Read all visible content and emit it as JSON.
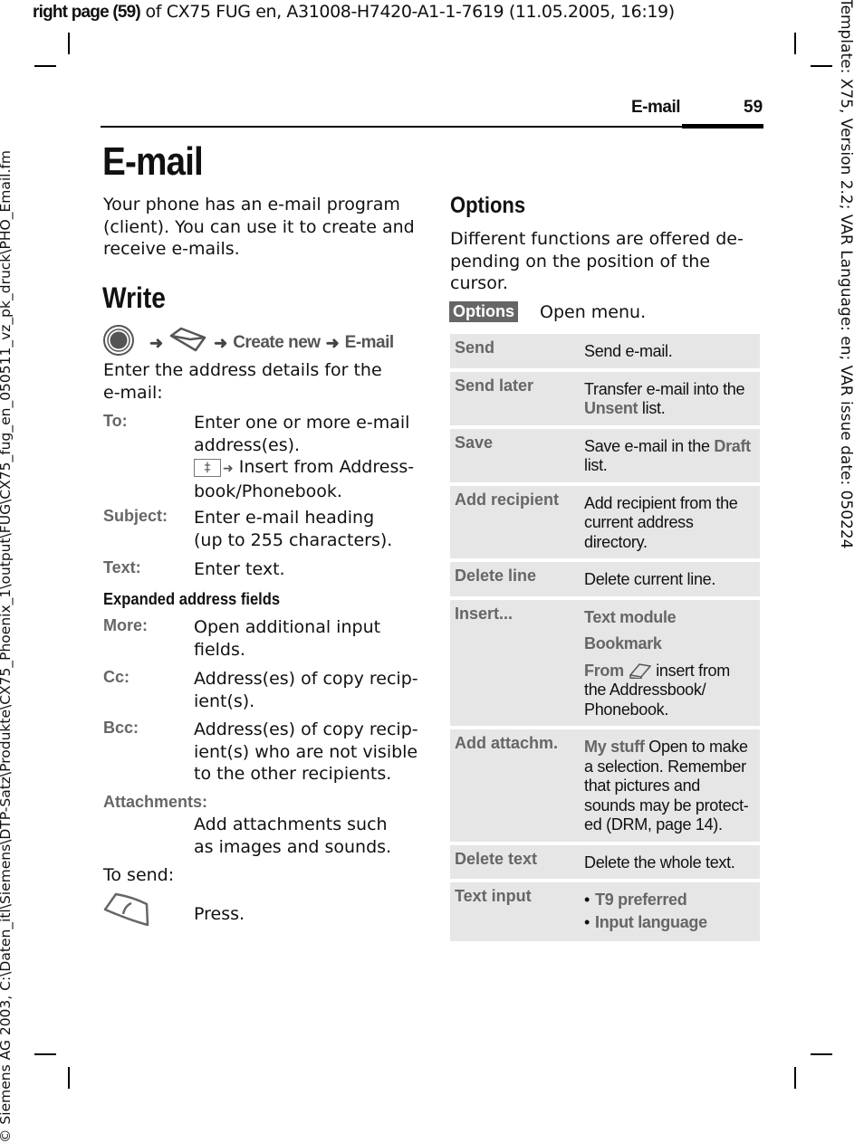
{
  "print_header": {
    "bold_part": "right page (59)",
    "rest": " of CX75 FUG en, A31008-H7420-A1-1-7619 (11.05.2005, 16:19)"
  },
  "side_left": "© Siemens AG 2003, C:\\Daten_itl\\Siemens\\DTP-Satz\\Produkte\\CX75_Phoenix_1\\output\\FUG\\CX75_fug_en_050511_vz_pk_druck\\PHO_Email.fm",
  "side_right": "Template: X75, Version 2.2; VAR Language: en; VAR issue date: 050224",
  "running_head": {
    "title": "E-mail",
    "page": "59"
  },
  "title": "E-mail",
  "intro": "Your phone has an e-mail program (client). You can use it to create and receive e-mails.",
  "write": {
    "heading": "Write",
    "nav": {
      "step1_icon": "joystick-icon",
      "step2_icon": "envelope-icon",
      "step3": "Create new",
      "step4": "E-mail",
      "arrow": "➜"
    },
    "instruction": "Enter the address details for the e-mail:",
    "fields": [
      {
        "term": "To:",
        "desc": "Enter one or more e-mail address(es).",
        "extra_key": "‡",
        "extra_arrow": "➜",
        "extra_text": "Insert from Address-book/Phonebook."
      },
      {
        "term": "Subject:",
        "desc": "Enter e-mail heading (up to 255 characters)."
      },
      {
        "term": "Text:",
        "desc": "Enter text."
      }
    ],
    "expanded_heading": "Expanded address fields",
    "expanded_fields": [
      {
        "term": "More:",
        "desc": "Open additional input fields."
      },
      {
        "term": "Cc:",
        "desc": "Address(es) of copy recip-ient(s)."
      },
      {
        "term": "Bcc:",
        "desc": "Address(es) of copy recip-ient(s) who are not visible to the other recipients."
      },
      {
        "term": "Attachments:",
        "desc": "Add attachments such as images and sounds."
      }
    ],
    "to_send": "To send:",
    "send_key_icon": "call-key-icon",
    "press": "Press."
  },
  "options": {
    "heading": "Options",
    "intro": "Different functions are offered de-pending on the position of the cursor.",
    "softkey": "Options",
    "softkey_desc": "Open menu.",
    "rows": [
      {
        "name": "Send",
        "desc": "Send e-mail."
      },
      {
        "name": "Send later",
        "desc_pre": "Transfer e-mail into the ",
        "desc_hl": "Unsent",
        "desc_post": " list."
      },
      {
        "name": "Save",
        "desc_pre": "Save e-mail in the ",
        "desc_hl": "Draft",
        "desc_post": " list."
      },
      {
        "name": "Add recipient",
        "desc": "Add recipient from the current address directory."
      },
      {
        "name": "Delete line",
        "desc": "Delete current line."
      },
      {
        "name": "Insert...",
        "items": [
          "Text module",
          "Bookmark"
        ],
        "from_hl": "From",
        "from_icon": "addressbook-icon",
        "from_text": " insert from the Addressbook/ Phonebook."
      },
      {
        "name": "Add attachm.",
        "desc_hl": "My stuff",
        "desc_post": " Open to make a selection. Remember that pictures and sounds may be protect-ed (DRM, page 14)."
      },
      {
        "name": "Delete text",
        "desc": "Delete the whole text."
      },
      {
        "name": "Text input",
        "bullets": [
          "T9 preferred",
          "Input language"
        ]
      }
    ]
  }
}
